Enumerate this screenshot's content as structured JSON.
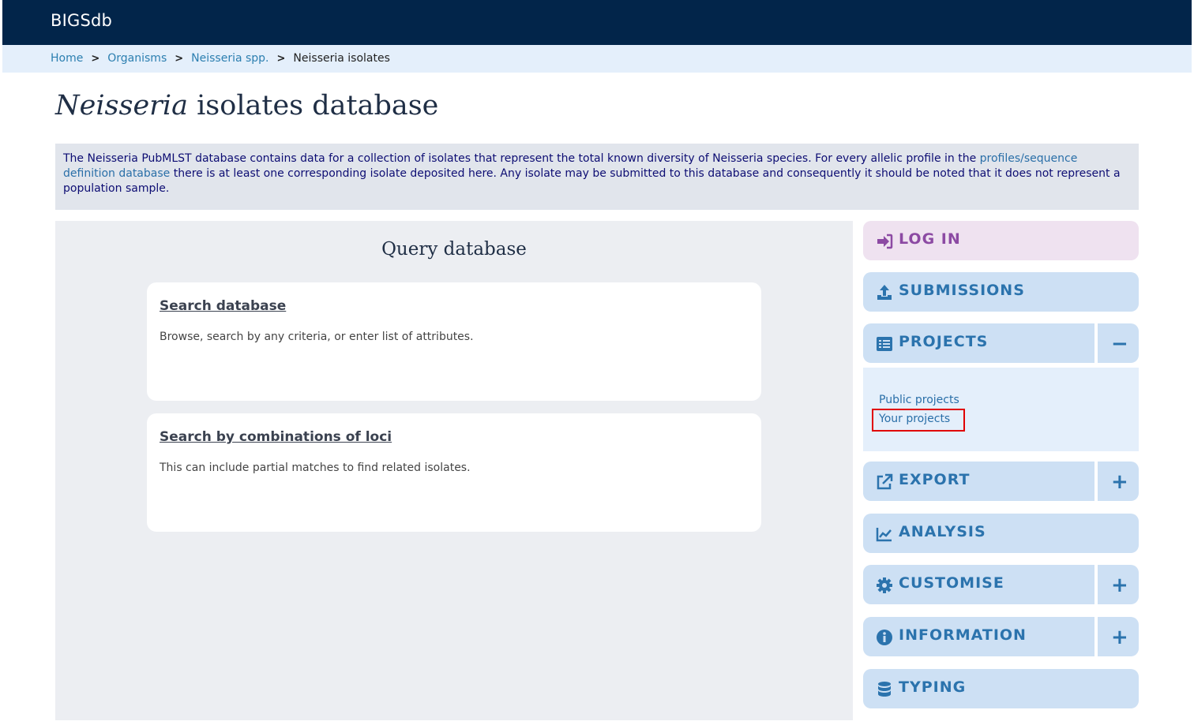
{
  "header": {
    "brand": "BIGSdb"
  },
  "breadcrumb": [
    {
      "label": "Home"
    },
    {
      "label": "Organisms"
    },
    {
      "label": "Neisseria spp."
    },
    {
      "label": "Neisseria isolates"
    }
  ],
  "breadcrumb_separator": ">",
  "page": {
    "title_italic": "Neisseria",
    "title_rest": " isolates database"
  },
  "description": {
    "text_before": "The Neisseria PubMLST database contains data for a collection of isolates that represent the total known diversity of Neisseria species. For every allelic profile in the ",
    "link": "profiles/sequence definition database",
    "text_after": " there is at least one corresponding isolate deposited here. Any isolate may be submitted to this database and consequently it should be noted that it does not represent a population sample."
  },
  "query": {
    "title": "Query database",
    "cards": [
      {
        "title": "Search database",
        "desc": "Browse, search by any criteria, or enter list of attributes."
      },
      {
        "title": "Search by combinations of loci",
        "desc": "This can include partial matches to find related isolates."
      }
    ]
  },
  "sidebar": {
    "login": "LOG IN",
    "submissions": "SUBMISSIONS",
    "projects": "PROJECTS",
    "projects_toggle": "−",
    "projects_links": [
      "Public projects",
      "Your projects"
    ],
    "export": "EXPORT",
    "export_toggle": "+",
    "analysis": "ANALYSIS",
    "customise": "CUSTOMISE",
    "customise_toggle": "+",
    "information": "INFORMATION",
    "information_toggle": "+",
    "typing": "TYPING"
  },
  "colors": {
    "topbar": "#02254a",
    "accent": "#2b73ad",
    "login_accent": "#8c4aa3",
    "highlight": "#e00000"
  }
}
